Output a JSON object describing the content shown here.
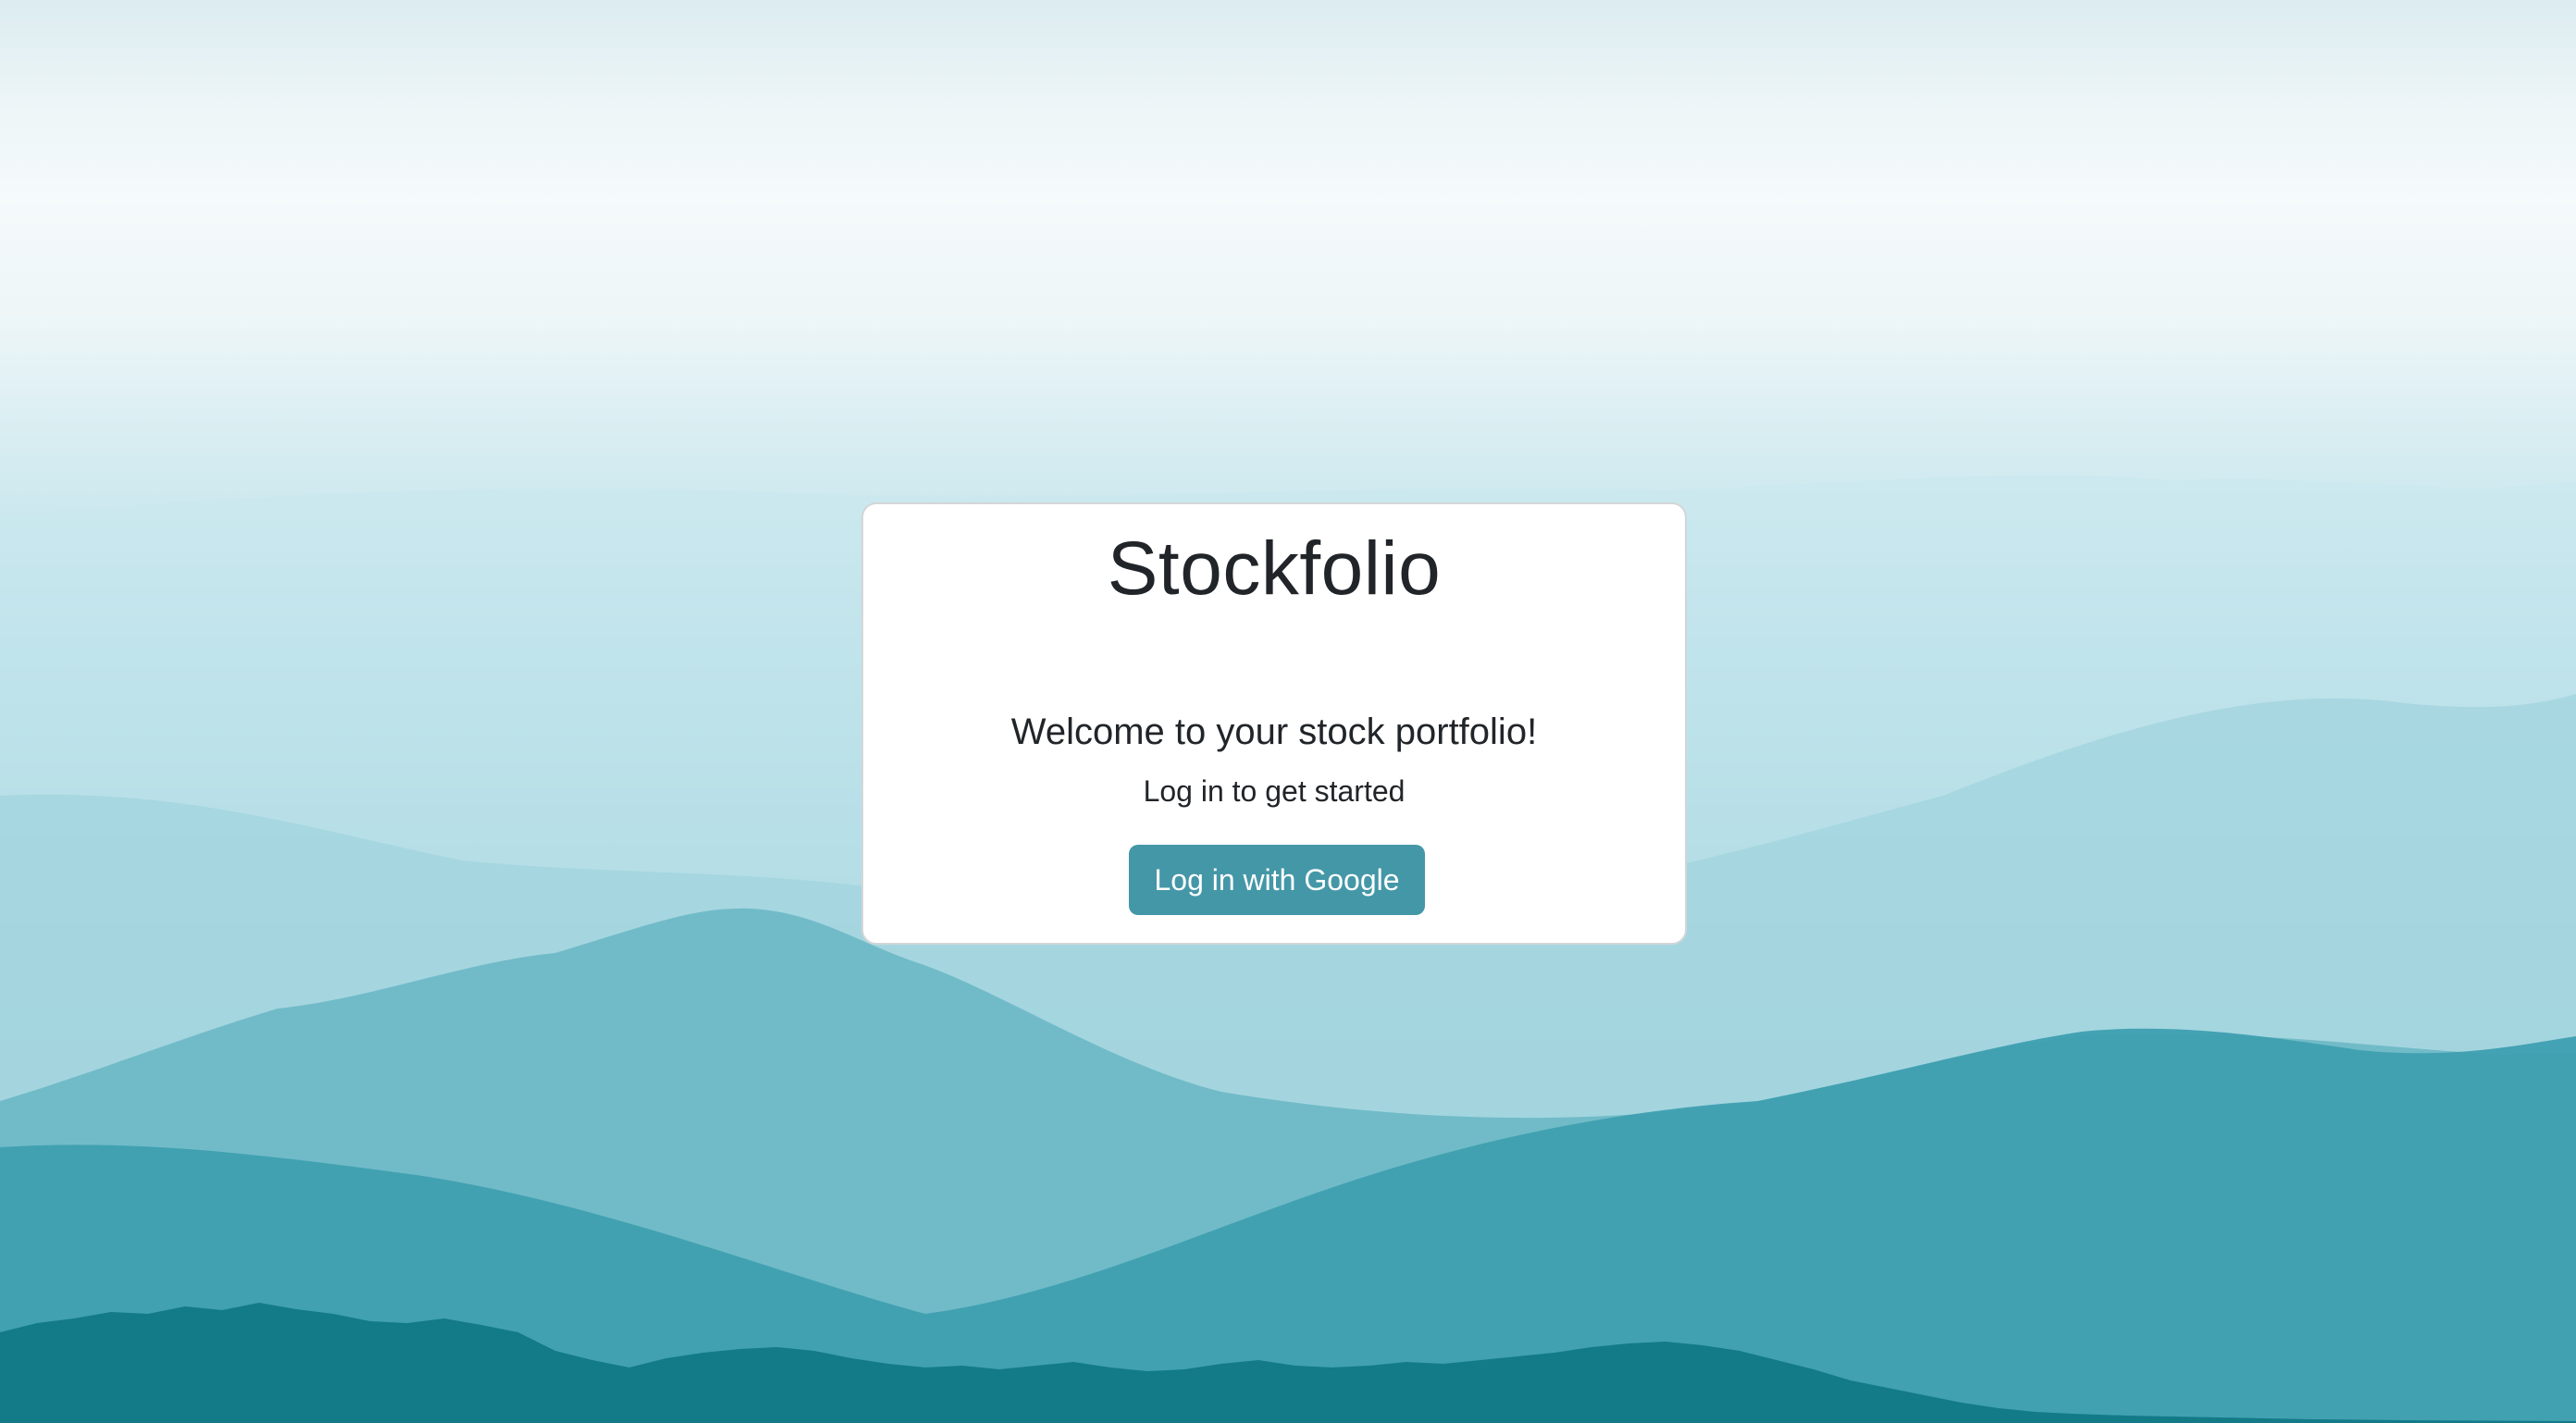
{
  "app": {
    "title": "Stockfolio"
  },
  "login_card": {
    "welcome_heading": "Welcome to your stock portfolio!",
    "subtitle": "Log in to get started",
    "google_button_label": "Log in with Google"
  },
  "colors": {
    "button_background": "#4497a7",
    "button_text": "#ffffff",
    "card_background": "#ffffff",
    "text_primary": "#212529",
    "background_sky": "#eef6f8",
    "background_mountains": "#0b7484"
  }
}
